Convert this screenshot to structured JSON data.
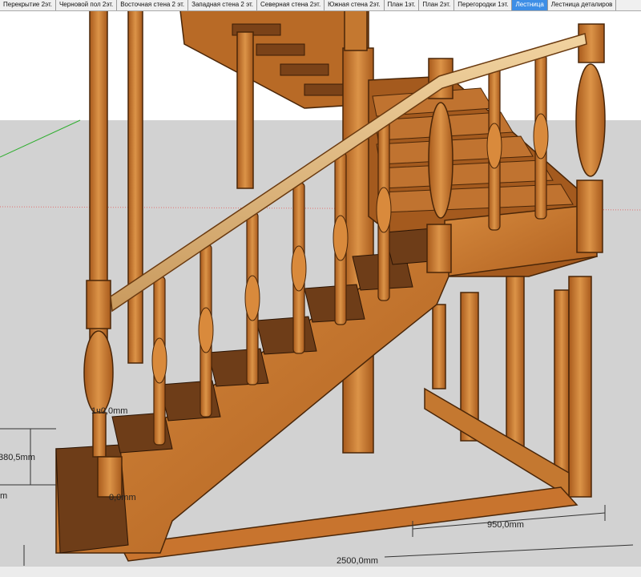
{
  "tabs": [
    {
      "label": "Перекрытие 2эт.",
      "active": false
    },
    {
      "label": "Черновой пол 2эт.",
      "active": false
    },
    {
      "label": "Восточная стена 2 эт.",
      "active": false
    },
    {
      "label": "Западная стена 2 эт.",
      "active": false
    },
    {
      "label": "Северная стена 2эт.",
      "active": false
    },
    {
      "label": "Южная стена 2эт.",
      "active": false
    },
    {
      "label": "План 1эт.",
      "active": false
    },
    {
      "label": "План 2эт.",
      "active": false
    },
    {
      "label": "Перегородки 1эт.",
      "active": false
    },
    {
      "label": "Лестница",
      "active": true
    },
    {
      "label": "Лестница деталиров",
      "active": false
    }
  ],
  "dimensions": {
    "d1": "1ч0,0mm",
    "d2": "380,5mm",
    "d3": "0,0mm",
    "d4": "950,0mm",
    "d5": "2500,0mm",
    "d6": "m"
  },
  "colors": {
    "sky": "#ffffff",
    "ground": "#d2d2d2",
    "wood": "#c8742e",
    "wood_dark": "#8a4a18",
    "tread": "#6e3d18",
    "active_tab": "#3d8ee6"
  },
  "scene": {
    "model": "wooden-staircase-with-balusters",
    "icons": [
      "staircase-model",
      "dimension-line",
      "axis-line"
    ]
  }
}
